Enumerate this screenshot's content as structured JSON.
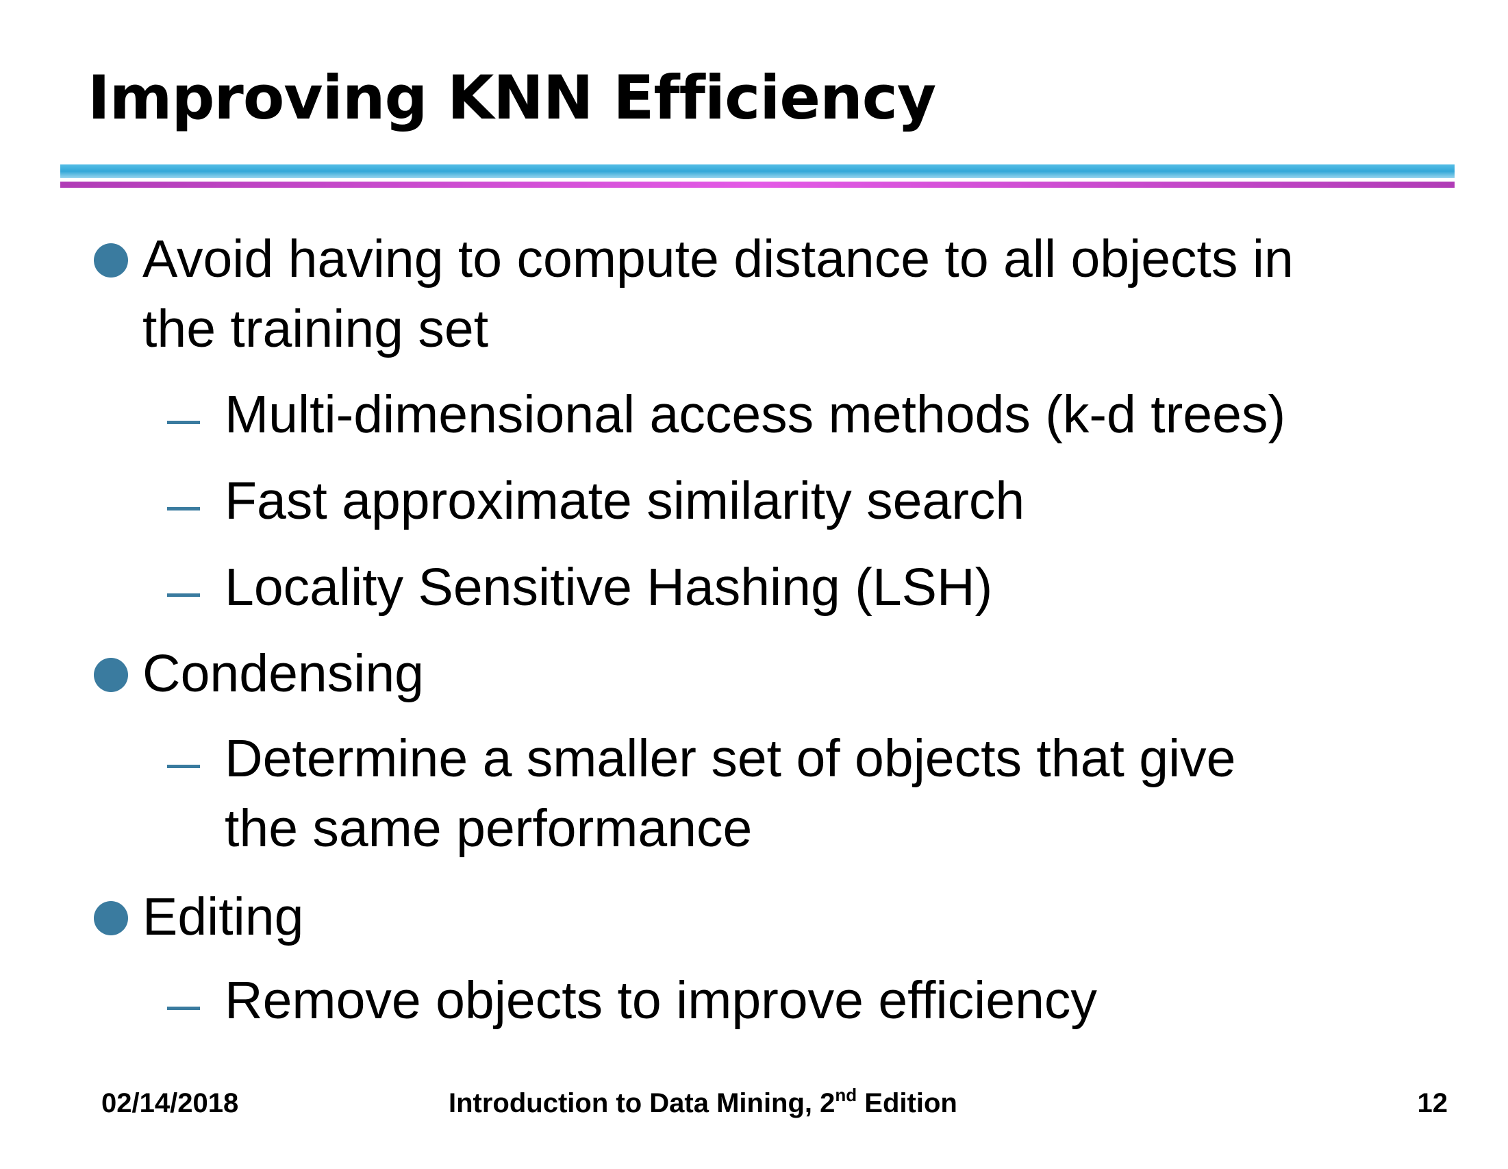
{
  "slide": {
    "title": "Improving KNN Efficiency",
    "accent_color": "#3a7b9f",
    "rule_colors": [
      "#3fb0dd",
      "#d24fd6"
    ],
    "points": [
      {
        "lines": [
          "Avoid having to compute distance to all objects in",
          "the training set"
        ],
        "subpoints": [
          {
            "lines": [
              "Multi-dimensional access methods (k-d trees)"
            ]
          },
          {
            "lines": [
              "Fast approximate similarity search"
            ]
          },
          {
            "lines": [
              "Locality Sensitive Hashing (LSH)"
            ]
          }
        ]
      },
      {
        "lines": [
          "Condensing"
        ],
        "subpoints": [
          {
            "lines": [
              "Determine a smaller set of objects that give",
              "the same performance"
            ]
          }
        ]
      },
      {
        "lines": [
          "Editing"
        ],
        "subpoints": [
          {
            "lines": [
              "Remove objects to improve efficiency"
            ]
          }
        ]
      }
    ]
  },
  "footer": {
    "date": "02/14/2018",
    "book_title": "Introduction to Data Mining, 2",
    "book_sup": "nd",
    "book_suffix": " Edition",
    "page_number": "12"
  }
}
